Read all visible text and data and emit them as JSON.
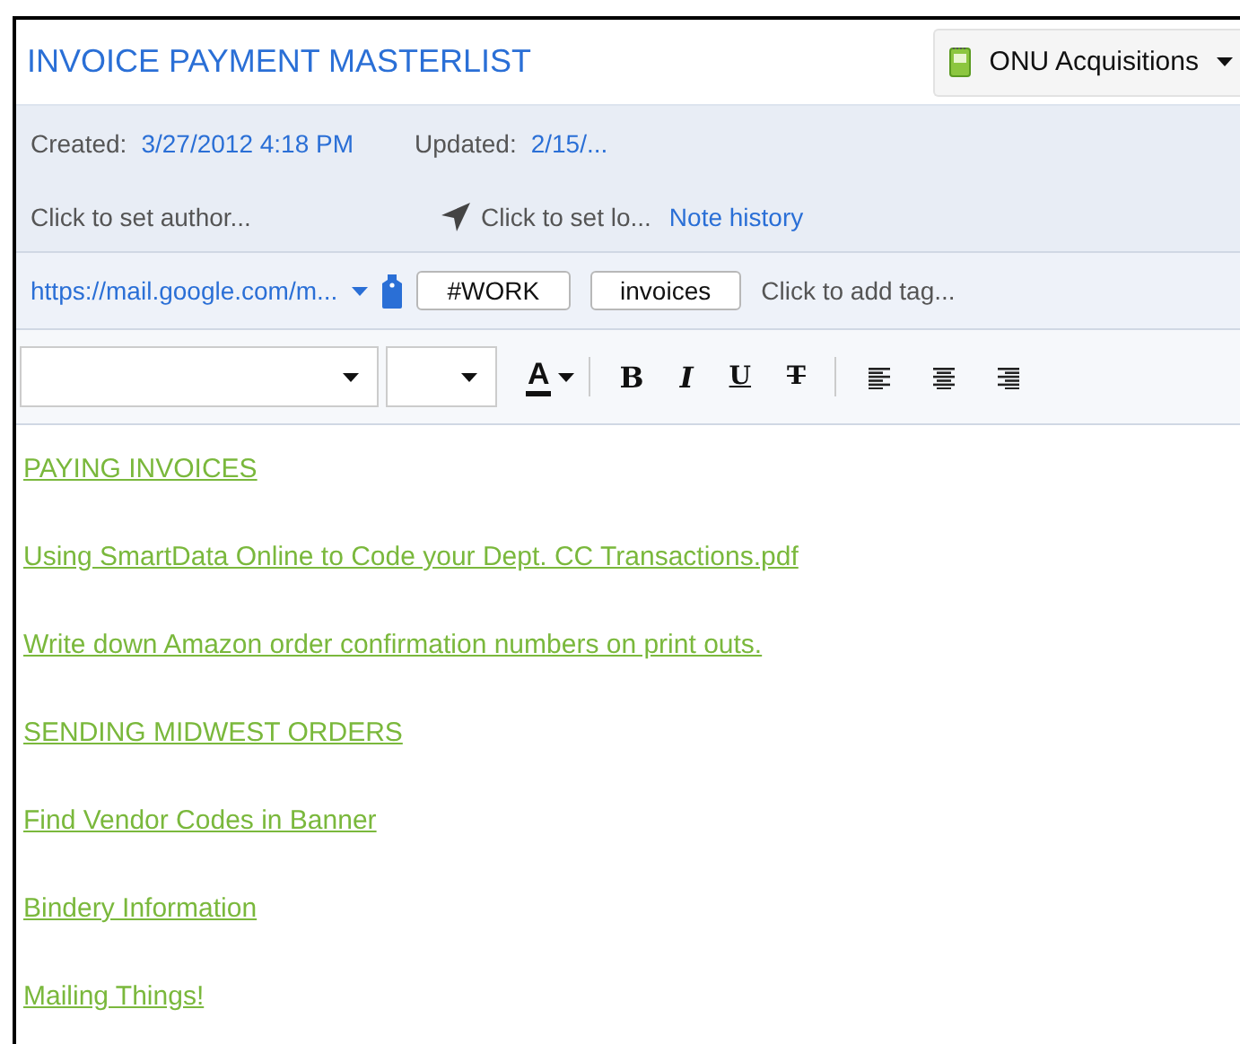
{
  "note": {
    "title": "INVOICE PAYMENT MASTERLIST",
    "notebook": "ONU Acquisitions"
  },
  "meta": {
    "created_label": "Created:",
    "created": "3/27/2012 4:18 PM",
    "updated_label": "Updated:",
    "updated": "2/15/...",
    "author_placeholder": "Click to set author...",
    "location_placeholder": "Click to set lo...",
    "history_link": "Note history"
  },
  "source_url": "https://mail.google.com/m...",
  "tags": [
    {
      "label": "#WORK"
    },
    {
      "label": "invoices"
    }
  ],
  "tag_placeholder": "Click to add tag...",
  "toolbar": [
    {
      "kind": "font-color",
      "label": "A"
    },
    {
      "kind": "bold",
      "label": "B"
    },
    {
      "kind": "italic",
      "label": "I"
    },
    {
      "kind": "underline",
      "label": "U"
    },
    {
      "kind": "strike",
      "label": "T"
    },
    {
      "kind": "align-left"
    },
    {
      "kind": "align-center"
    },
    {
      "kind": "align-right"
    }
  ],
  "links": [
    "PAYING INVOICES",
    "Using SmartData Online to Code your Dept. CC Transactions.pdf",
    "Write down Amazon order confirmation numbers on print outs.",
    "SENDING MIDWEST ORDERS",
    "Find Vendor Codes in Banner",
    "Bindery Information",
    "Mailing Things!"
  ]
}
